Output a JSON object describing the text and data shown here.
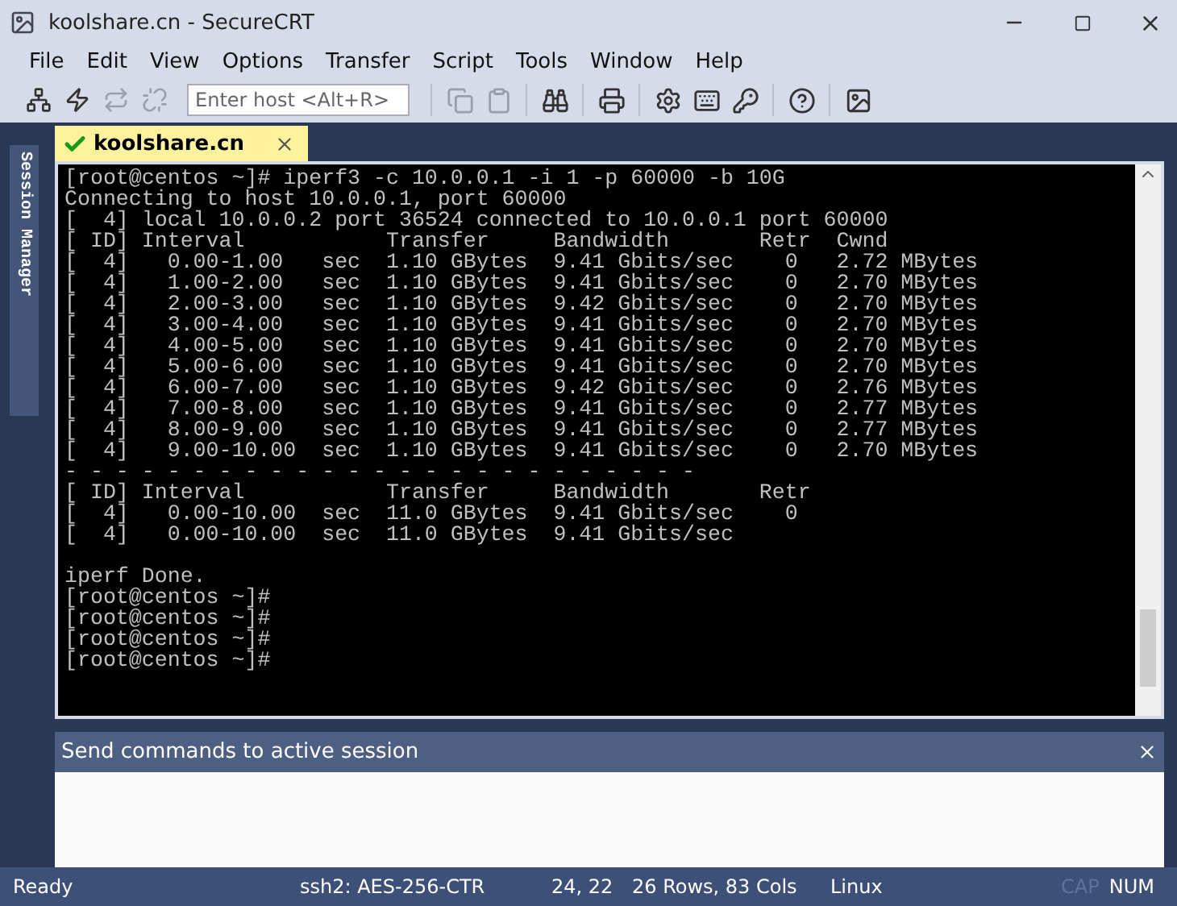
{
  "window": {
    "title": "koolshare.cn - SecureCRT"
  },
  "menu": [
    "File",
    "Edit",
    "View",
    "Options",
    "Transfer",
    "Script",
    "Tools",
    "Window",
    "Help"
  ],
  "toolbar": {
    "buttons": [
      {
        "disabled": false
      },
      {
        "disabled": false
      },
      {
        "disabled": true
      },
      {
        "disabled": true
      }
    ],
    "host_field": {
      "placeholder": "Enter host <Alt+R>"
    },
    "buttons_after": [
      {
        "disabled": true
      },
      {
        "disabled": true
      },
      {
        "disabled": false
      },
      {
        "disabled": false
      },
      {
        "disabled": false
      },
      {
        "disabled": false
      },
      {
        "disabled": false
      },
      {
        "disabled": false
      },
      {
        "disabled": false
      }
    ]
  },
  "session_manager": {
    "label": "Session Manager"
  },
  "tabs": [
    {
      "label": "koolshare.cn",
      "selected": true,
      "connected": true
    }
  ],
  "terminal": {
    "blocks": [
      [
        "[root@centos ~]# iperf3 -c 10.0.0.1 -i 1 -p 60000 -b 10G",
        "Connecting to host 10.0.0.1, port 60000",
        "[  4] local 10.0.0.2 port 36524 connected to 10.0.0.1 port 60000",
        "[ ID] Interval           Transfer     Bandwidth       Retr  Cwnd",
        "[  4]   0.00-1.00   sec  1.10 GBytes  9.41 Gbits/sec    0   2.72 MBytes",
        "[  4]   1.00-2.00   sec  1.10 GBytes  9.41 Gbits/sec    0   2.70 MBytes",
        "[  4]   2.00-3.00   sec  1.10 GBytes  9.42 Gbits/sec    0   2.70 MBytes",
        "[  4]   3.00-4.00   sec  1.10 GBytes  9.41 Gbits/sec    0   2.70 MBytes",
        "[  4]   4.00-5.00   sec  1.10 GBytes  9.41 Gbits/sec    0   2.70 MBytes",
        "[  4]   5.00-6.00   sec  1.10 GBytes  9.41 Gbits/sec    0   2.70 MBytes",
        "[  4]   6.00-7.00   sec  1.10 GBytes  9.42 Gbits/sec    0   2.76 MBytes",
        "[  4]   7.00-8.00   sec  1.10 GBytes  9.41 Gbits/sec    0   2.77 MBytes",
        "[  4]   8.00-9.00   sec  1.10 GBytes  9.41 Gbits/sec    0   2.77 MBytes",
        "[  4]   9.00-10.00  sec  1.10 GBytes  9.41 Gbits/sec    0   2.70 MBytes",
        "- - - - - - - - - - - - - - - - - - - - - - - - -",
        "[ ID] Interval           Transfer     Bandwidth       Retr",
        "[  4]   0.00-10.00  sec  11.0 GBytes  9.41 Gbits/sec    0",
        "[  4]   0.00-10.00  sec  11.0 GBytes  9.41 Gbits/sec"
      ],
      [
        "iperf Done.",
        "[root@centos ~]#",
        "[root@centos ~]#",
        "[root@centos ~]#",
        "[root@centos ~]#"
      ]
    ]
  },
  "command_window": {
    "title": "Send commands to active session"
  },
  "status_bar": {
    "items": [
      "Ready",
      "ssh2: AES-256-CTR",
      "24,  22",
      "26 Rows, 83 Cols",
      "Linux"
    ],
    "keys": [
      {
        "label": "CAP",
        "on": false
      },
      {
        "label": "NUM",
        "on": true
      }
    ]
  }
}
